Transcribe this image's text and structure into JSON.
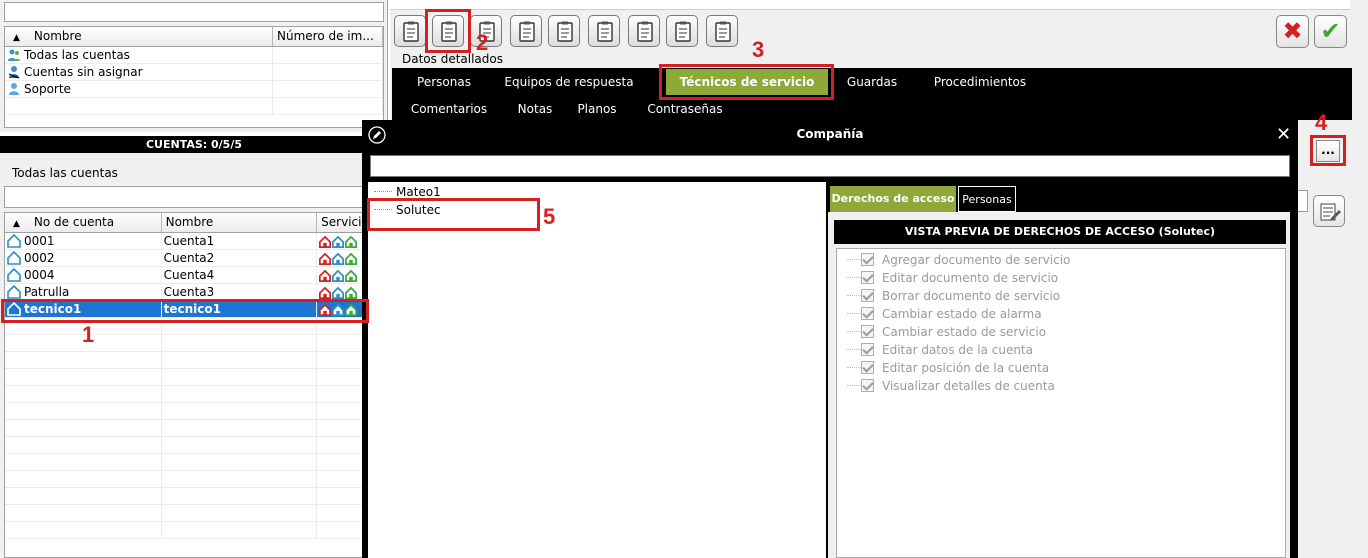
{
  "left_top": {
    "columns": [
      "Nombre",
      "Número de im..."
    ],
    "sort_icon": "sort-up-triangle",
    "rows": [
      {
        "icon": "group-users-icon",
        "name": "Todas las cuentas",
        "num": ""
      },
      {
        "icon": "user-unassigned-icon",
        "name": "Cuentas sin asignar",
        "num": ""
      },
      {
        "icon": "user-support-icon",
        "name": "Soporte",
        "num": ""
      }
    ]
  },
  "cuentas_bar": "CUENTAS: 0/5/5",
  "left_bottom": {
    "title": "Todas las cuentas",
    "columns": [
      "No de cuenta",
      "Nombre",
      "Servicio"
    ],
    "rows": [
      {
        "no": "0001",
        "name": "Cuenta1"
      },
      {
        "no": "0002",
        "name": "Cuenta2"
      },
      {
        "no": "0004",
        "name": "Cuenta4"
      },
      {
        "no": "Patrulla",
        "name": "Cuenta3"
      },
      {
        "no": "tecnico1",
        "name": "tecnico1",
        "selected": true
      }
    ]
  },
  "toolbar": {
    "buttons": [
      "sitemap-info-icon",
      "account-info-icon",
      "document-list-icon",
      "signal-doc-icon",
      "search-doc-icon",
      "tree-doc-icon",
      "invoice-icon",
      "certificate-icon",
      "notes-doc-icon"
    ],
    "cancel_symbol": "✖",
    "accept_symbol": "✔"
  },
  "datos_detallados": "Datos detallados",
  "tabs_row1": [
    "Personas",
    "Equipos de respuesta",
    "Técnicos de servicio",
    "Guardas",
    "Procedimientos"
  ],
  "tabs_row2": [
    "Comentarios",
    "Notas",
    "Planos",
    "Contraseñas"
  ],
  "active_tab": "Técnicos de servicio",
  "dialog": {
    "title": "Compañía",
    "close_symbol": "✕",
    "tree": [
      "Mateo1",
      "Solutec"
    ],
    "right_tabs": [
      "Derechos de acceso",
      "Personas"
    ],
    "preview_header": "VISTA PREVIA DE DERECHOS DE ACCESO (Solutec)",
    "permissions": [
      "Agregar documento de servicio",
      "Editar documento de servicio",
      "Borrar documento de servicio",
      "Cambiar estado de alarma",
      "Cambiar estado de servicio",
      "Editar datos de la cuenta",
      "Editar posición de la cuenta",
      "Visualizar detalles de cuenta"
    ]
  },
  "more_button": "...",
  "annotations": [
    "1",
    "2",
    "3",
    "4",
    "5"
  ],
  "colors": {
    "accent_green": "#8ea83a",
    "selection_blue": "#1e76d2",
    "annotation_red": "#d42020"
  }
}
